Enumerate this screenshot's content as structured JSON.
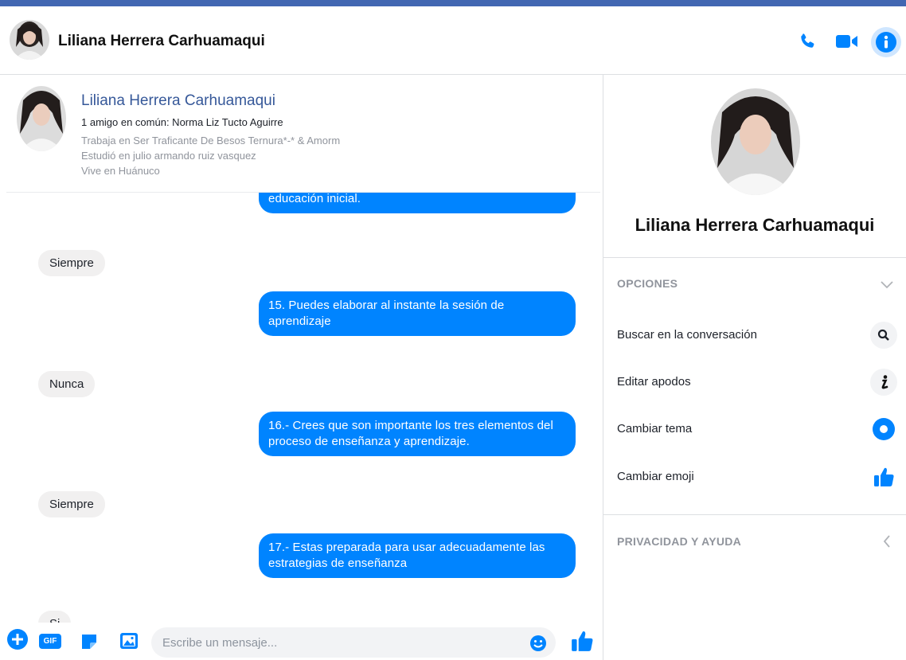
{
  "header": {
    "contact_name": "Liliana Herrera Carhuamaqui"
  },
  "profile_card": {
    "name": "Liliana Herrera Carhuamaqui",
    "mutual_friends": "1 amigo en común: Norma Liz Tucto Aguirre",
    "work": "Trabaja en Ser Traficante De Besos Ternura*-* & Amorm",
    "education": "Estudió en julio armando ruiz vasquez",
    "lives": "Vive en Huánuco"
  },
  "messages": [
    {
      "from": "me",
      "text": "educación inicial."
    },
    {
      "from": "them",
      "text": "Siempre"
    },
    {
      "from": "me",
      "text": "15. Puedes elaborar al instante la sesión de aprendizaje"
    },
    {
      "from": "them",
      "text": "Nunca"
    },
    {
      "from": "me",
      "text": "16.- Crees que son importante los tres elementos del proceso de enseñanza y aprendizaje."
    },
    {
      "from": "them",
      "text": "Siempre"
    },
    {
      "from": "me",
      "text": "17.- Estas preparada para usar adecuadamente las estrategias de enseñanza"
    },
    {
      "from": "them",
      "text": "Si"
    }
  ],
  "right_panel": {
    "name": "Liliana Herrera Carhuamaqui",
    "options_header": "OPCIONES",
    "options": [
      {
        "label": "Buscar en la conversación",
        "icon": "search-icon"
      },
      {
        "label": "Editar apodos",
        "icon": "edit-nickname-icon"
      },
      {
        "label": "Cambiar tema",
        "icon": "theme-color-icon"
      },
      {
        "label": "Cambiar emoji",
        "icon": "thumbs-up-icon"
      }
    ],
    "privacy_header": "PRIVACIDAD Y AYUDA"
  },
  "composer": {
    "gif_label": "GIF",
    "placeholder": "Escribe un mensaje..."
  },
  "colors": {
    "accent": "#0084ff",
    "top_bar": "#4267b2",
    "incoming_bubble": "#f1f0f0"
  }
}
